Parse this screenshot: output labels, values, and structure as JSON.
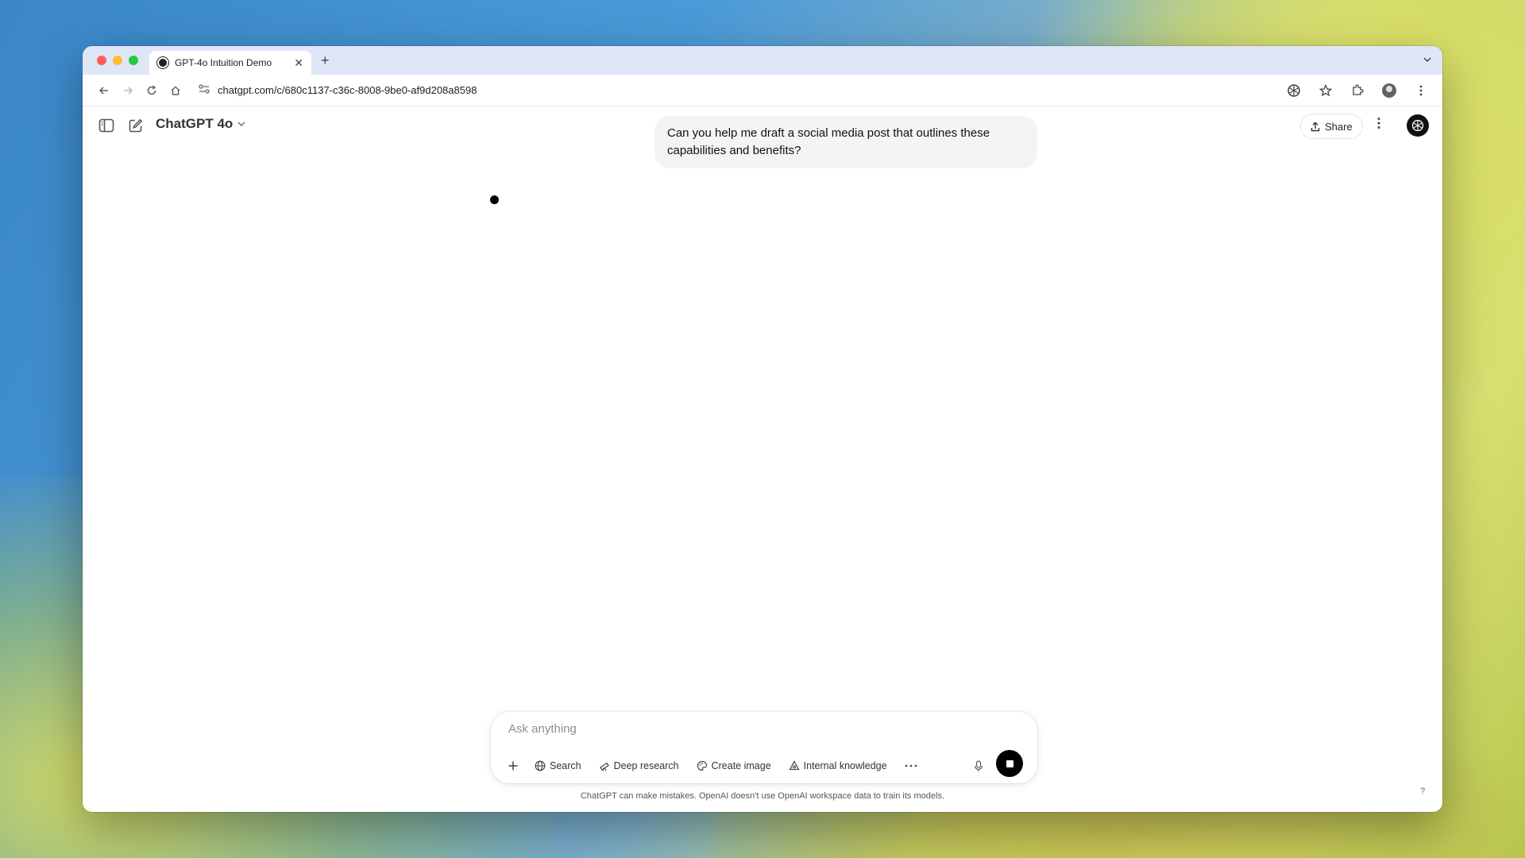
{
  "browser": {
    "tab_title": "GPT-4o Intuition Demo",
    "tab_close": "✕",
    "new_tab": "+",
    "url": "chatgpt.com/c/680c1137-c36c-8008-9be0-af9d208a8598"
  },
  "header": {
    "model_name": "ChatGPT 4o",
    "share_label": "Share"
  },
  "conversation": {
    "user_message": "Can you help me draft a social media post that outlines these capabilities and benefits?"
  },
  "composer": {
    "placeholder": "Ask anything",
    "tools": {
      "search": "Search",
      "deep_research": "Deep research",
      "create_image": "Create image",
      "internal_knowledge": "Internal knowledge"
    }
  },
  "footer": {
    "disclaimer": "ChatGPT can make mistakes. OpenAI doesn't use OpenAI workspace data to train its models.",
    "help": "?"
  },
  "icons": {
    "sidebar_toggle": "sidebar-icon",
    "new_chat": "compose-icon",
    "profile": "openai-logo-icon"
  },
  "colors": {
    "stop_button": "#000000",
    "user_bubble": "#f4f4f4",
    "tab_strip": "#dfe6f7"
  }
}
